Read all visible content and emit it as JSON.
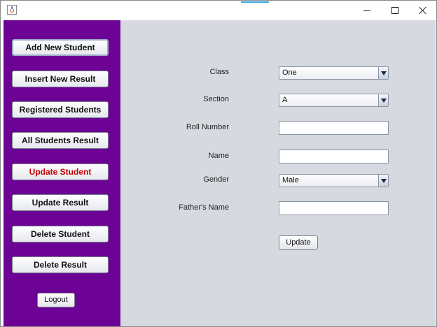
{
  "window": {
    "icon": "java-cup-icon",
    "controls": {
      "minimize_icon": "minimize-icon",
      "maximize_icon": "maximize-icon",
      "close_icon": "close-icon"
    }
  },
  "sidebar": {
    "background": "#6c0394",
    "buttons": [
      {
        "label": "Add New Student"
      },
      {
        "label": "Insert New Result"
      },
      {
        "label": "Registered Students"
      },
      {
        "label": "All Students Result"
      },
      {
        "label": "Update Student",
        "color": "#c40000"
      },
      {
        "label": "Update Result"
      },
      {
        "label": "Delete Student"
      },
      {
        "label": "Delete Result"
      }
    ],
    "logout_label": "Logout"
  },
  "form": {
    "class": {
      "label": "Class",
      "value": "One"
    },
    "section": {
      "label": "Section",
      "value": "A"
    },
    "roll_number": {
      "label": "Roll Number",
      "value": ""
    },
    "name": {
      "label": "Name",
      "value": ""
    },
    "gender": {
      "label": "Gender",
      "value": "Male"
    },
    "fathers_name": {
      "label": "Father's Name",
      "value": ""
    },
    "update_label": "Update"
  }
}
